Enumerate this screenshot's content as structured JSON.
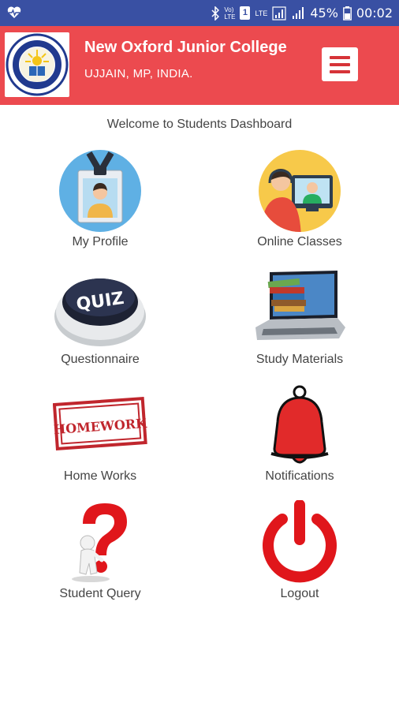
{
  "status_bar": {
    "network_labels": [
      "Vo)",
      "LTE"
    ],
    "sim_label": "1",
    "lte_label": "LTE",
    "battery": "45%",
    "time": "00:02"
  },
  "header": {
    "title": "New Oxford Junior College",
    "subtitle": "UJJAIN, MP, INDIA.",
    "logo_text_top": "NEW OXFORD JUNIOR COLLEGE",
    "logo_text_bottom": "UJJAIN"
  },
  "welcome": "Welcome to Students Dashboard",
  "tiles": [
    {
      "label": "My Profile",
      "icon": "profile-icon"
    },
    {
      "label": "Online Classes",
      "icon": "online-classes-icon"
    },
    {
      "label": "Questionnaire",
      "icon": "quiz-icon",
      "badge": "QUIZ"
    },
    {
      "label": "Study Materials",
      "icon": "study-materials-icon"
    },
    {
      "label": "Home Works",
      "icon": "homework-stamp-icon",
      "badge": "HOMEWORK"
    },
    {
      "label": "Notifications",
      "icon": "bell-icon"
    },
    {
      "label": "Student Query",
      "icon": "question-mark-icon"
    },
    {
      "label": "Logout",
      "icon": "power-icon"
    }
  ],
  "colors": {
    "status_bar": "#3950a3",
    "header": "#ec4a4f",
    "menu_bars": "#d63338",
    "text": "#444444"
  }
}
